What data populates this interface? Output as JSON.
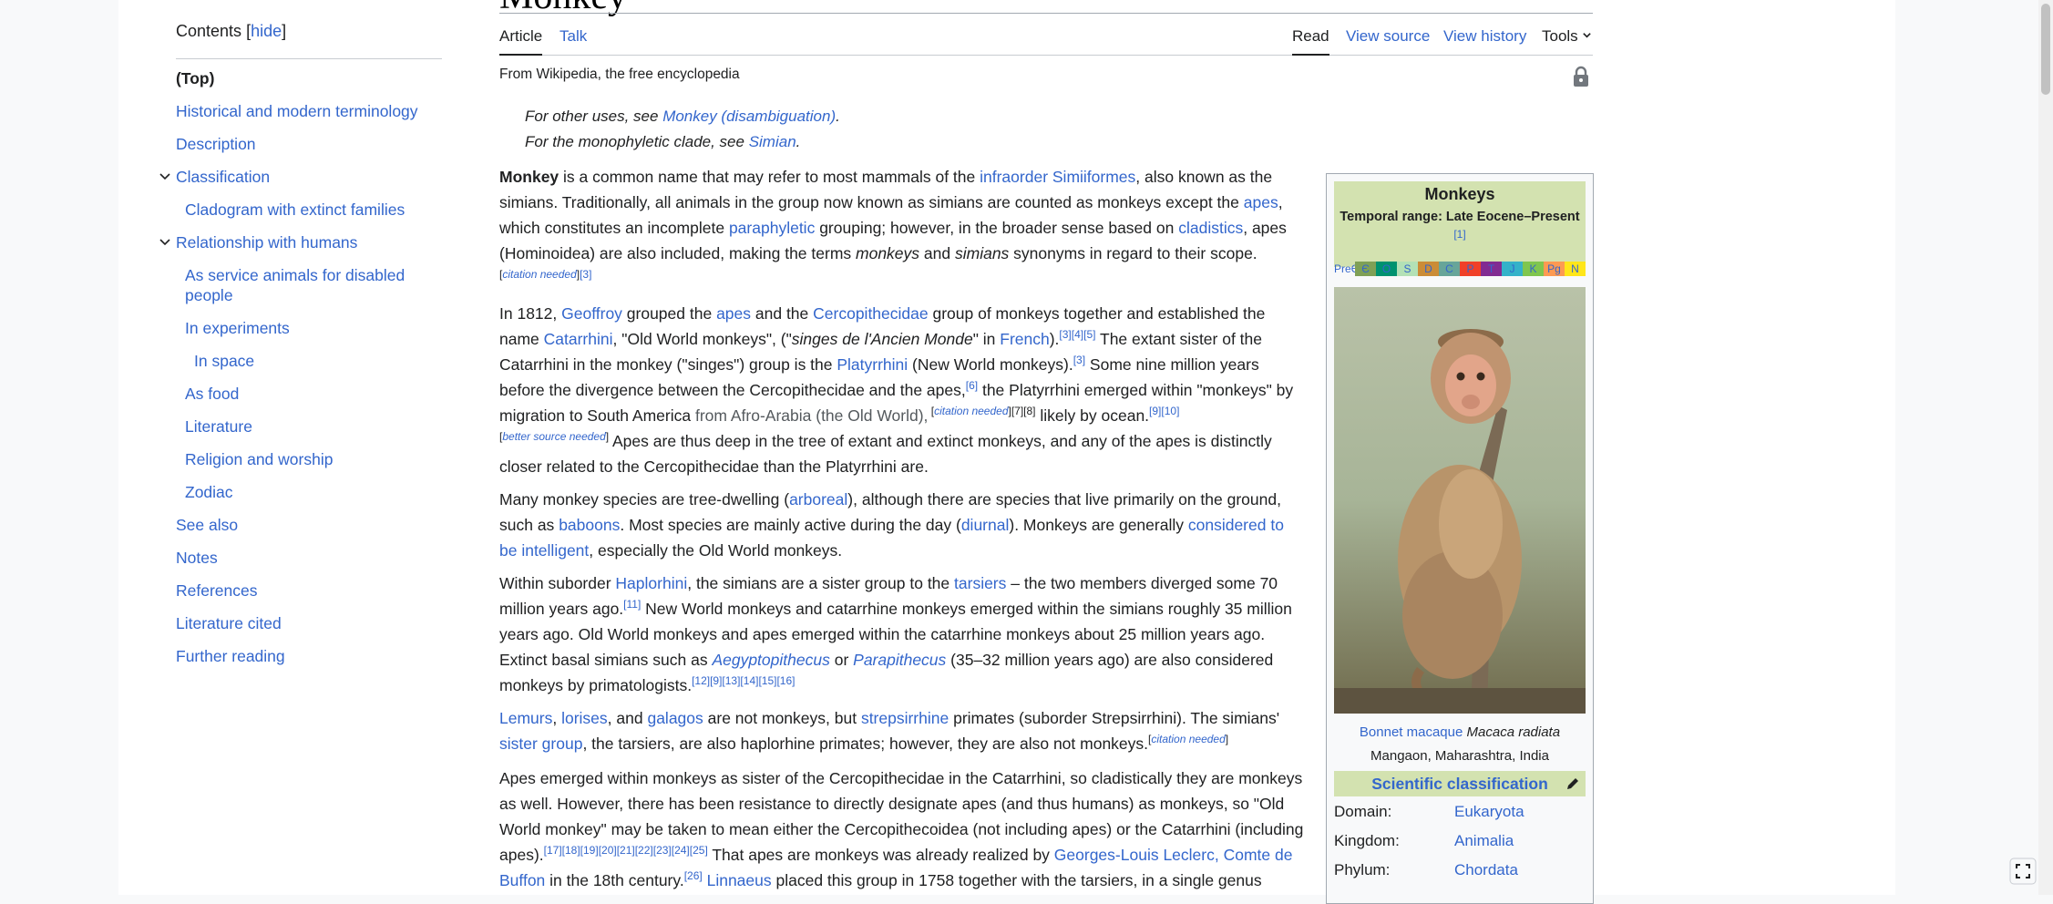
{
  "article": {
    "title": "Monkey",
    "tabs": {
      "article": "Article",
      "talk": "Talk",
      "read": "Read",
      "view_source": "View source",
      "view_history": "View history",
      "tools": "Tools"
    },
    "tagline": "From Wikipedia, the free encyclopedia",
    "hatnotes": [
      {
        "prefix": "For other uses, see ",
        "link": "Monkey (disambiguation)",
        "suffix": "."
      },
      {
        "prefix": "For the monophyletic clade, see ",
        "link": "Simian",
        "suffix": "."
      }
    ]
  },
  "toc": {
    "title": "Contents",
    "hide_open": "[",
    "hide": "hide",
    "hide_close": "]",
    "items": [
      {
        "label": "(Top)",
        "level": 1
      },
      {
        "label": "Historical and modern terminology",
        "level": 1
      },
      {
        "label": "Description",
        "level": 1
      },
      {
        "label": "Classification",
        "level": 1,
        "expandable": true
      },
      {
        "label": "Cladogram with extinct families",
        "level": 2
      },
      {
        "label": "Relationship with humans",
        "level": 1,
        "expandable": true
      },
      {
        "label": "As service animals for disabled people",
        "level": 2
      },
      {
        "label": "In experiments",
        "level": 2
      },
      {
        "label": "In space",
        "level": 3
      },
      {
        "label": "As food",
        "level": 2
      },
      {
        "label": "Literature",
        "level": 2
      },
      {
        "label": "Religion and worship",
        "level": 2
      },
      {
        "label": "Zodiac",
        "level": 2
      },
      {
        "label": "See also",
        "level": 1
      },
      {
        "label": "Notes",
        "level": 1
      },
      {
        "label": "References",
        "level": 1
      },
      {
        "label": "Literature cited",
        "level": 1
      },
      {
        "label": "Further reading",
        "level": 1
      }
    ]
  },
  "paragraphs": {
    "p1": {
      "bold": "Monkey",
      "t1": " is a common name that may refer to most mammals of the ",
      "l1": "infraorder Simiiformes",
      "t2": ", also known as the simians. Traditionally, all animals in the group now known as simians are counted as monkeys except the ",
      "l2": "apes",
      "t3": ", which constitutes an incomplete ",
      "l3": "paraphyletic",
      "t4": " grouping; however, in the broader sense based on ",
      "l4": "cladistics",
      "t5": ", apes (Hominoidea) are also included, making the terms ",
      "i1": "monkeys",
      "t6": " and ",
      "i2": "simians",
      "t7": " synonyms in regard to their scope.",
      "s1": "[",
      "s1i": "citation needed",
      "s1b": "]",
      "s2": "[3]"
    },
    "p2": {
      "t1": "In 1812, ",
      "l1": "Geoffroy",
      "t2": " grouped the ",
      "l2": "apes",
      "t3": " and the ",
      "l3": "Cercopithecidae",
      "t4": " group of monkeys together and established the name ",
      "l4": "Catarrhini",
      "t5": ", \"Old World monkeys\", (\"",
      "i1": "singes de l'Ancien Monde",
      "t6": "\" in ",
      "l5": "French",
      "t7": ").",
      "s1": "[3][4][5]",
      "t8": " The extant sister of the Catarrhini in the monkey (\"singes\") group is the ",
      "l6": "Platyrrhini",
      "t9": " (New World monkeys).",
      "s2": "[3]",
      "t10": " Some nine million years before the divergence between the Cercopithecidae and the apes,",
      "s3": "[6]",
      "t11": " the Platyrrhini emerged within \"monkeys\" by migration to South America ",
      "g1": "from Afro-Arabia (the Old World),",
      "s4": " [",
      "s4i": "citation needed",
      "s4b": "][7][8]",
      "t12": " likely by ocean.",
      "s5": "[9][10]",
      "s6": "[",
      "s6i": "better source needed",
      "s6b": "]",
      "t13": " Apes are thus deep in the tree of extant and extinct monkeys, and any of the apes is distinctly closer related to the Cercopithecidae than the Platyrrhini are."
    },
    "p3": {
      "t1": "Many monkey species are tree-dwelling (",
      "l1": "arboreal",
      "t2": "), although there are species that live primarily on the ground, such as ",
      "l2": "baboons",
      "t3": ". Most species are mainly active during the day (",
      "l3": "diurnal",
      "t4": "). Monkeys are generally ",
      "l4": "considered to be intelligent",
      "t5": ", especially the Old World monkeys."
    },
    "p4": {
      "t1": "Within suborder ",
      "l1": "Haplorhini",
      "t2": ", the simians are a sister group to the ",
      "l2": "tarsiers",
      "t3": " – the two members diverged some 70 million years ago.",
      "s1": "[11]",
      "t4": " New World monkeys and catarrhine monkeys emerged within the simians roughly 35 million years ago. Old World monkeys and apes emerged within the catarrhine monkeys about 25 million years ago. Extinct basal simians such as ",
      "l3": "Aegyptopithecus",
      "t5": " or ",
      "l4": "Parapithecus",
      "t6": " (35–32 million years ago) are also considered monkeys by primatologists.",
      "s2": "[12][9][13][14][15][16]"
    },
    "p5": {
      "l1": "Lemurs",
      "t1": ", ",
      "l2": "lorises",
      "t2": ", and ",
      "l3": "galagos",
      "t3": " are not monkeys, but ",
      "l4": "strepsirrhine",
      "t4": " primates (suborder Strepsirrhini). The simians' ",
      "l5": "sister group",
      "t5": ", the tarsiers, are also haplorhine primates; however, they are also not monkeys.",
      "s1": "[",
      "s1i": "citation needed",
      "s1b": "]"
    },
    "p6": {
      "t1": "Apes emerged within monkeys as sister of the Cercopithecidae in the Catarrhini, so cladistically they are monkeys as well. However, there has been resistance to directly designate apes (and thus humans) as monkeys, so \"Old World monkey\" may be taken to mean either the Cercopithecoidea (not including apes) or the Catarrhini (including apes).",
      "s1": "[17][18][19][20][21][22][23][24][25]",
      "t2": " That apes are monkeys was already realized by ",
      "l1": "Georges-Louis Leclerc, Comte de Buffon",
      "t3": " in the 18th century.",
      "s2": "[26]",
      "t4": " ",
      "l2": "Linnaeus",
      "t5": " placed this group in 1758 together with the tarsiers, in a single genus"
    }
  },
  "infobox": {
    "title": "Monkeys",
    "temporal_range": "Temporal range: Late Eocene–Present",
    "ref": "[1]",
    "timeline": [
      "PreЄ",
      "Є",
      "O",
      "S",
      "D",
      "C",
      "P",
      "T",
      "J",
      "K",
      "Pg",
      "N"
    ],
    "timeline_colors": [
      "#f74370",
      "#7fa056",
      "#009270",
      "#b3e1b6",
      "#cb8c37",
      "#67a599",
      "#f04028",
      "#812b92",
      "#34b2c9",
      "#7fc64e",
      "#fd9a52",
      "#ffe619"
    ],
    "caption_link": "Bonnet macaque",
    "caption_italic": "Macaca radiata",
    "caption_place": "Mangaon, Maharashtra, India",
    "classification_label": "Scientific classification",
    "rows": [
      {
        "k": "Domain:",
        "v": "Eukaryota"
      },
      {
        "k": "Kingdom:",
        "v": "Animalia"
      },
      {
        "k": "Phylum:",
        "v": "Chordata"
      }
    ]
  },
  "icons": {
    "lock": "lock-icon",
    "pencil": "pencil-icon",
    "chevron": "chevron-down-icon",
    "expand": "expand-icon"
  },
  "colors": {
    "link": "#3366cc",
    "taxobox": "#d3e2b0",
    "text": "#202122"
  }
}
